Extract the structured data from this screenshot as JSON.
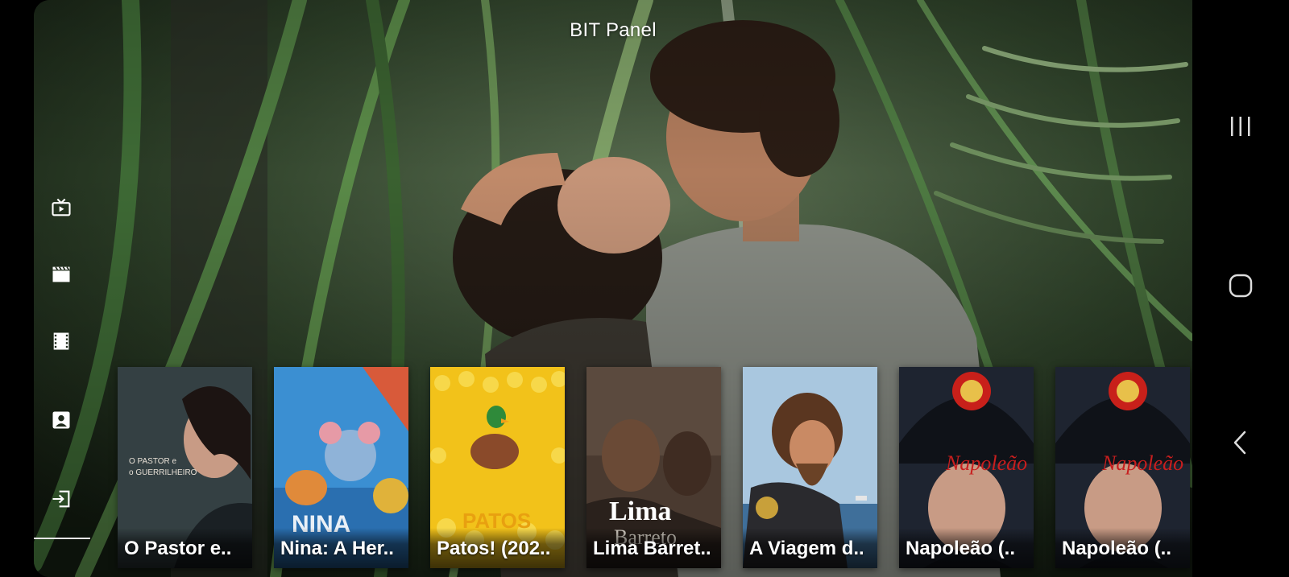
{
  "app": {
    "title": "BIT Panel"
  },
  "sidebar": {
    "items": [
      {
        "icon": "live-tv-icon",
        "label": "Live TV"
      },
      {
        "icon": "movies-icon",
        "label": "Movies"
      },
      {
        "icon": "series-icon",
        "label": "Series"
      },
      {
        "icon": "account-icon",
        "label": "Account"
      },
      {
        "icon": "logout-icon",
        "label": "Logout"
      }
    ]
  },
  "rail": {
    "cards": [
      {
        "title": "O Pastor e..",
        "poster_text": "O PASTOR e o GUERRILHEIRO"
      },
      {
        "title": "Nina: A Her..",
        "poster_text": "NINA"
      },
      {
        "title": "Patos! (202..",
        "poster_text": "PATOS"
      },
      {
        "title": "Lima Barret..",
        "poster_text": "Lima Barreto"
      },
      {
        "title": "A Viagem d..",
        "poster_text": ""
      },
      {
        "title": "Napoleão (..",
        "poster_text": "Napoleão"
      },
      {
        "title": "Napoleão (..",
        "poster_text": "Napoleão"
      }
    ]
  },
  "system_nav": {
    "recents": "recents-icon",
    "home": "home-icon",
    "back": "back-icon"
  },
  "colors": {
    "background": "#000000",
    "foliage": "#2f4a2c",
    "text": "#ffffff"
  }
}
